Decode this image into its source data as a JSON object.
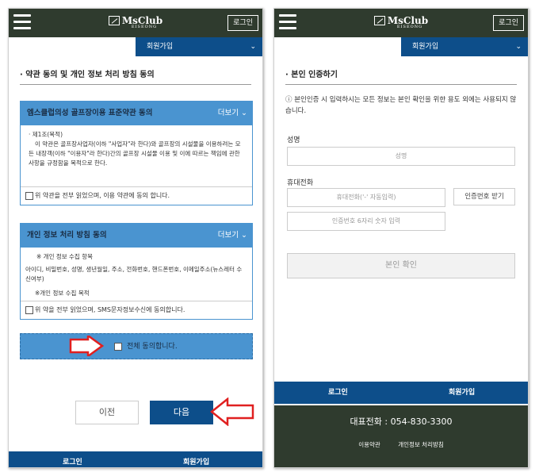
{
  "header": {
    "logo_text": "MsClub",
    "logo_sub": "EISEONG",
    "login_label": "로그인"
  },
  "subnav": {
    "label": "회원가입"
  },
  "left": {
    "section_title": "· 약관 동의 및 개인 정보 처리 방침 동의",
    "terms1": {
      "title": "엠스클럽의성 골프장이용 표준약관 동의",
      "more": "더보기",
      "article": "· 제1조(목적)",
      "body": "이 약관은 골프장사업자(이하 \"사업자\"라 한다)와 골프장의 시설물을 이용하려는 모든 내장객(이하 \"이용자\"라 한다)간의 골프장 시설물 이용 및 이에 따르는 책임에 관한 사항을 규정함을 목적으로 한다.",
      "agree": "위 약관을 전부 읽었으며, 이용 약관에 동의 합니다."
    },
    "terms2": {
      "title": "개인 정보 처리 방침 동의",
      "more": "더보기",
      "item_header": "※ 개인 정보 수집 항목",
      "items": "아이디, 비밀번호, 성명, 생년월일, 주소, 전화번호, 핸드폰번호, 이메일주소(뉴스레터 수신여부)",
      "purpose_header": "※개인 정보 수집 목적",
      "agree": "위 약을 전부 읽었으며, SMS문자정보수신에 동의합니다."
    },
    "all_agree": "전체 동의합니다.",
    "prev_label": "이전",
    "next_label": "다음",
    "footer": {
      "login": "로그인",
      "join": "회원가입"
    }
  },
  "right": {
    "section_title": "· 본인 인증하기",
    "notice": "ⓘ 본인인증 시 입력하시는 모든 정보는 본인 확인을 위한 용도 외에는 사용되지 않습니다.",
    "name_label": "성명",
    "name_placeholder": "성명",
    "phone_label": "휴대전화",
    "phone_placeholder": "휴대전화('-' 자동입력)",
    "code_button": "인증번호 받기",
    "code_placeholder": "인증번호 6자리 숫자 입력",
    "confirm_label": "본인 확인",
    "footer": {
      "login": "로그인",
      "join": "회원가입",
      "phone": "대표전화 : 054-830-3300",
      "terms_link": "이용약관",
      "privacy_link": "개인정보 처리방침"
    }
  },
  "colors": {
    "header_bg": "#2f3b2e",
    "nav_blue": "#0d4e8a",
    "light_blue": "#4a94d0",
    "arrow_red": "#e02020"
  },
  "icons": [
    "hamburger-icon",
    "chevron-down-icon",
    "red-arrow-icon"
  ]
}
